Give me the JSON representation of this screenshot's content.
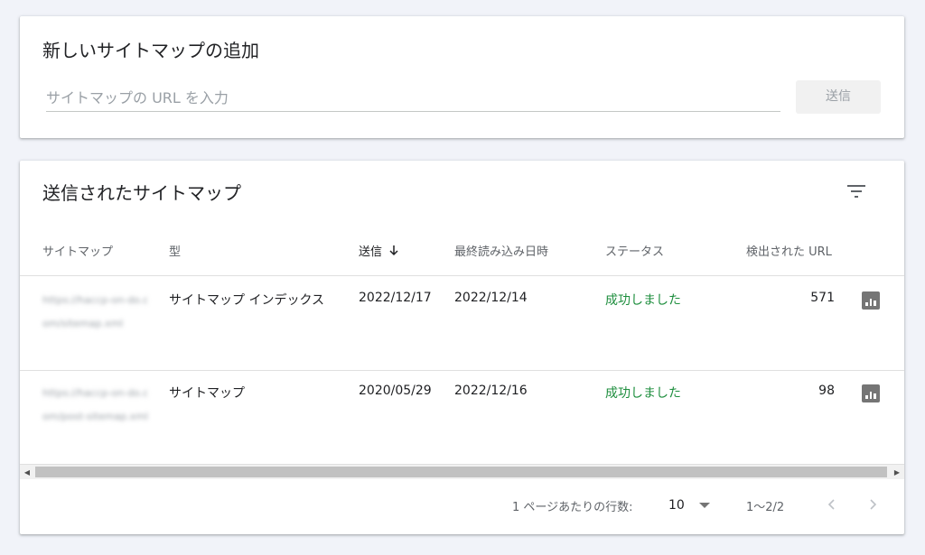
{
  "add_sitemap": {
    "title": "新しいサイトマップの追加",
    "input_placeholder": "サイトマップの URL を入力",
    "input_value": "",
    "submit_label": "送信"
  },
  "submitted": {
    "title": "送信されたサイトマップ",
    "columns": {
      "sitemap": "サイトマップ",
      "type": "型",
      "submitted": "送信",
      "last_read": "最終読み込み日時",
      "status": "ステータス",
      "discovered_urls": "検出された URL"
    },
    "rows": [
      {
        "sitemap": "https://haccp-on-do.com/sitemap.xml",
        "type": "サイトマップ インデックス",
        "submitted": "2022/12/17",
        "last_read": "2022/12/14",
        "status": "成功しました",
        "discovered_urls": "571"
      },
      {
        "sitemap": "https://haccp-on-do.com/post-sitemap.xml",
        "type": "サイトマップ",
        "submitted": "2020/05/29",
        "last_read": "2022/12/16",
        "status": "成功しました",
        "discovered_urls": "98"
      }
    ],
    "pagination": {
      "rows_per_page_label": "1 ページあたりの行数:",
      "rows_per_page_value": "10",
      "range": "1〜2/2"
    }
  },
  "icons": {
    "filter": "filter-icon",
    "sort": "arrow-down-icon",
    "chart": "bar-chart-icon",
    "prev": "chevron-left-icon",
    "next": "chevron-right-icon"
  },
  "colors": {
    "success": "#1e8e3e",
    "background": "#f1f3f9"
  }
}
